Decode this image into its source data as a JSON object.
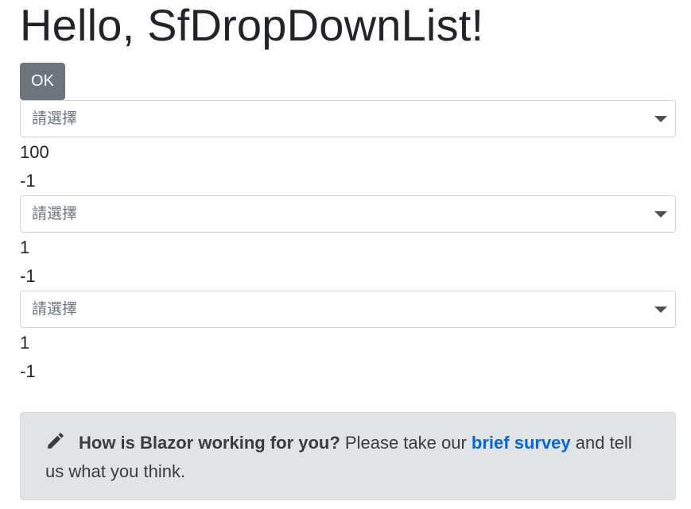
{
  "page": {
    "title": "Hello, SfDropDownList!"
  },
  "ok_button": {
    "label": "OK"
  },
  "groups": [
    {
      "placeholder": "請選擇",
      "value1": "100",
      "value2": "-1"
    },
    {
      "placeholder": "請選擇",
      "value1": "1",
      "value2": "-1"
    },
    {
      "placeholder": "請選擇",
      "value1": "1",
      "value2": "-1"
    }
  ],
  "survey": {
    "icon": "pencil-icon",
    "question": "How is Blazor working for you?",
    "text_before_link": "Please take our",
    "link_text": "brief survey",
    "text_after_link": "and tell us what you think."
  },
  "colors": {
    "button_bg": "#6c757d",
    "survey_bg": "#e2e3e5",
    "link": "#0366d6"
  }
}
